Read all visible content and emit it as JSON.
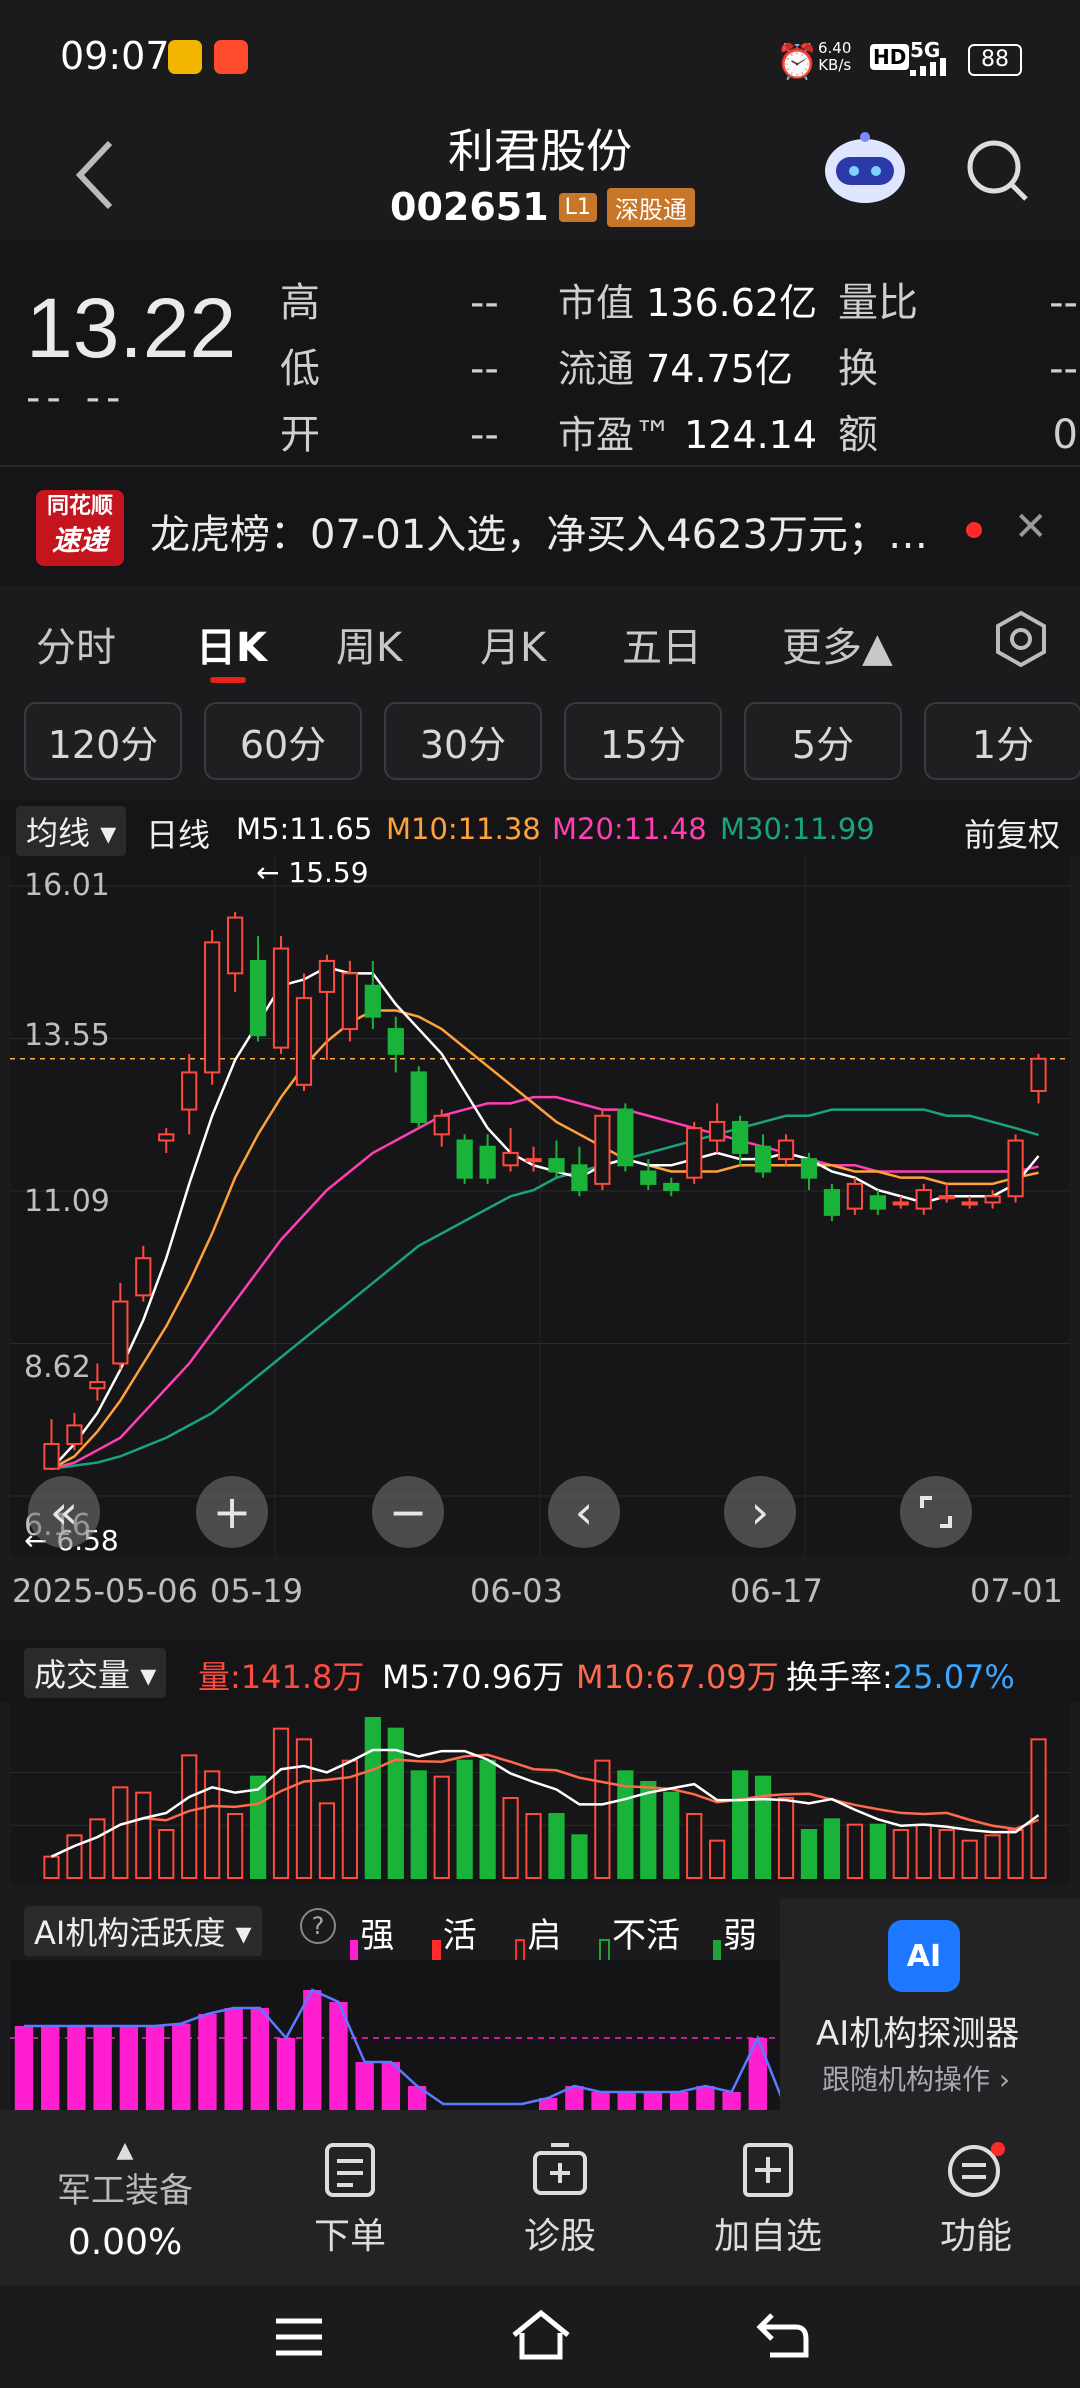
{
  "status_bar": {
    "time": "09:07",
    "net_speed_top": "6.40",
    "net_speed_unit": "KB/s",
    "hd": "HD",
    "signal": "5G",
    "battery": "88"
  },
  "header": {
    "title": "利君股份",
    "code": "002651",
    "badge_l1": "L1",
    "badge_market": "深股通"
  },
  "quote": {
    "price": "13.22",
    "change": "-- --",
    "high_label": "高",
    "high": "--",
    "low_label": "低",
    "low": "--",
    "open_label": "开",
    "open": "--",
    "mktcap_label": "市值",
    "mktcap": "136.62亿",
    "float_label": "流通",
    "float": "74.75亿",
    "pe_label": "市盈™",
    "pe": "124.14",
    "volratio_label": "量比",
    "volratio": "--",
    "turnover_label": "换",
    "turnover": "--",
    "amount_label": "额",
    "amount": "0"
  },
  "news": {
    "logo_top": "同花顺",
    "logo_bottom": "速递",
    "text": "龙虎榜：07-01入选，净买入4623万元；…"
  },
  "period_tabs": [
    "分时",
    "日K",
    "周K",
    "月K",
    "五日",
    "更多▲"
  ],
  "minute_chips": [
    "120分",
    "60分",
    "30分",
    "15分",
    "5分",
    "1分"
  ],
  "ma_bar": {
    "selector": "均线",
    "type": "日线",
    "m5": "M5:11.65",
    "m10": "M10:11.38",
    "m20": "M20:11.48",
    "m30": "M30:11.99",
    "adjust": "前复权"
  },
  "price_axis": [
    "16.01",
    "13.55",
    "11.09",
    "8.62",
    "6.16"
  ],
  "date_axis": [
    "2025-05-06",
    "05-19",
    "06-03",
    "06-17",
    "07-01"
  ],
  "max_marker": "15.59",
  "min_marker": "6.58",
  "chart_data": {
    "type": "candlestick",
    "ylim": [
      6.16,
      16.01
    ],
    "candles": [
      [
        6.6,
        7.0,
        7.4,
        6.58
      ],
      [
        7.0,
        7.3,
        7.5,
        6.9
      ],
      [
        7.9,
        8.0,
        8.3,
        7.7
      ],
      [
        8.3,
        9.3,
        9.6,
        8.2
      ],
      [
        9.4,
        10.0,
        10.2,
        9.3
      ],
      [
        11.9,
        12.0,
        12.1,
        11.7
      ],
      [
        12.4,
        13.0,
        13.3,
        12.0
      ],
      [
        13.0,
        15.1,
        15.3,
        12.8
      ],
      [
        14.6,
        15.5,
        15.59,
        14.3
      ],
      [
        14.8,
        13.6,
        15.2,
        13.5
      ],
      [
        13.4,
        15.0,
        15.2,
        13.3
      ],
      [
        12.8,
        14.2,
        14.6,
        12.7
      ],
      [
        14.3,
        14.8,
        14.9,
        13.2
      ],
      [
        13.7,
        14.6,
        14.8,
        13.5
      ],
      [
        14.4,
        13.9,
        14.8,
        13.7
      ],
      [
        13.7,
        13.3,
        13.9,
        13.0
      ],
      [
        13.0,
        12.2,
        13.1,
        12.1
      ],
      [
        12.0,
        12.3,
        12.4,
        11.8
      ],
      [
        11.9,
        11.3,
        12.0,
        11.2
      ],
      [
        11.8,
        11.3,
        12.0,
        11.2
      ],
      [
        11.5,
        11.7,
        12.1,
        11.4
      ],
      [
        11.6,
        11.6,
        11.8,
        11.4
      ],
      [
        11.6,
        11.4,
        11.9,
        11.3
      ],
      [
        11.5,
        11.1,
        11.8,
        11.0
      ],
      [
        11.2,
        12.3,
        12.4,
        11.1
      ],
      [
        12.4,
        11.5,
        12.5,
        11.4
      ],
      [
        11.4,
        11.2,
        11.6,
        11.1
      ],
      [
        11.2,
        11.1,
        11.3,
        11.0
      ],
      [
        11.3,
        12.1,
        12.2,
        11.2
      ],
      [
        11.9,
        12.2,
        12.5,
        11.7
      ],
      [
        12.2,
        11.7,
        12.3,
        11.5
      ],
      [
        11.8,
        11.4,
        12.0,
        11.3
      ],
      [
        11.6,
        11.9,
        12.0,
        11.5
      ],
      [
        11.6,
        11.3,
        11.7,
        11.1
      ],
      [
        11.1,
        10.7,
        11.2,
        10.6
      ],
      [
        10.8,
        11.2,
        11.3,
        10.7
      ],
      [
        11.0,
        10.8,
        11.1,
        10.7
      ],
      [
        10.9,
        10.9,
        11.0,
        10.8
      ],
      [
        10.8,
        11.1,
        11.2,
        10.7
      ],
      [
        11.0,
        11.0,
        11.2,
        10.9
      ],
      [
        10.9,
        10.9,
        11.0,
        10.8
      ],
      [
        10.9,
        11.0,
        11.1,
        10.8
      ],
      [
        11.0,
        11.9,
        12.0,
        10.9
      ],
      [
        12.7,
        13.22,
        13.3,
        12.5
      ]
    ],
    "ma5": [
      6.6,
      7.0,
      7.5,
      8.2,
      9.0,
      10.0,
      11.2,
      12.3,
      13.2,
      13.8,
      14.4,
      14.5,
      14.7,
      14.6,
      14.6,
      14.1,
      13.7,
      13.3,
      12.7,
      12.1,
      11.7,
      11.5,
      11.4,
      11.3,
      11.5,
      11.6,
      11.5,
      11.5,
      11.6,
      11.7,
      11.6,
      11.6,
      11.7,
      11.6,
      11.4,
      11.3,
      11.1,
      11.0,
      10.9,
      11.0,
      11.0,
      11.0,
      11.2,
      11.65
    ],
    "ma10": [
      6.6,
      6.8,
      7.2,
      7.7,
      8.3,
      8.9,
      9.6,
      10.4,
      11.3,
      12.0,
      12.6,
      13.1,
      13.5,
      13.8,
      14.0,
      14.0,
      13.9,
      13.7,
      13.4,
      13.1,
      12.8,
      12.5,
      12.2,
      12.0,
      11.8,
      11.6,
      11.5,
      11.4,
      11.4,
      11.4,
      11.5,
      11.5,
      11.5,
      11.5,
      11.5,
      11.4,
      11.4,
      11.3,
      11.3,
      11.2,
      11.2,
      11.2,
      11.3,
      11.38
    ],
    "ma20": [
      6.6,
      6.7,
      6.9,
      7.1,
      7.5,
      7.9,
      8.3,
      8.8,
      9.3,
      9.8,
      10.3,
      10.7,
      11.1,
      11.4,
      11.7,
      11.9,
      12.1,
      12.3,
      12.4,
      12.5,
      12.5,
      12.6,
      12.6,
      12.5,
      12.4,
      12.4,
      12.3,
      12.2,
      12.1,
      12.0,
      11.9,
      11.8,
      11.7,
      11.6,
      11.5,
      11.5,
      11.4,
      11.4,
      11.4,
      11.4,
      11.4,
      11.4,
      11.4,
      11.48
    ],
    "ma30": [
      6.6,
      6.65,
      6.7,
      6.8,
      6.95,
      7.1,
      7.3,
      7.5,
      7.8,
      8.1,
      8.4,
      8.7,
      9.0,
      9.3,
      9.6,
      9.9,
      10.2,
      10.4,
      10.6,
      10.8,
      11.0,
      11.1,
      11.3,
      11.4,
      11.5,
      11.6,
      11.7,
      11.8,
      11.9,
      12.0,
      12.1,
      12.2,
      12.3,
      12.3,
      12.4,
      12.4,
      12.4,
      12.4,
      12.4,
      12.3,
      12.3,
      12.2,
      12.1,
      11.99
    ],
    "volume": [
      20,
      40,
      55,
      85,
      80,
      45,
      115,
      100,
      60,
      95,
      140,
      130,
      70,
      110,
      150,
      140,
      100,
      95,
      110,
      110,
      75,
      60,
      60,
      40,
      110,
      100,
      90,
      80,
      60,
      35,
      100,
      95,
      75,
      45,
      55,
      50,
      50,
      45,
      50,
      45,
      35,
      40,
      45,
      130
    ],
    "ai_activity": [
      70,
      70,
      70,
      70,
      70,
      70,
      72,
      80,
      85,
      85,
      60,
      100,
      90,
      40,
      40,
      20,
      5,
      5,
      5,
      5,
      10,
      20,
      15,
      15,
      15,
      15,
      20,
      15,
      60,
      5,
      5,
      5,
      5,
      5,
      5,
      30,
      55,
      60,
      35,
      5,
      5,
      5,
      5,
      5
    ]
  },
  "volume_bar": {
    "selector": "成交量",
    "vol": "量:141.8万",
    "m5": "M5:70.96万",
    "m10": "M10:67.09万",
    "turnover_label": "换手率:",
    "turnover": "25.07%"
  },
  "ai_bar": {
    "selector": "AI机构活跃度",
    "help": "?",
    "legend": [
      "强势",
      "活跃",
      "启动",
      "不活跃",
      "弱势"
    ]
  },
  "ai_promo": {
    "icon": "AI",
    "title": "AI机构探测器",
    "subtitle": "跟随机构操作 ›"
  },
  "bottom_nav": {
    "sector": "军工装备",
    "sector_pct": "0.00%",
    "items": [
      "下单",
      "诊股",
      "加自选",
      "功能"
    ]
  },
  "colors": {
    "up": "#ff4a3d",
    "down": "#19b33a",
    "ma5": "#ffffff",
    "ma10": "#ffa23a",
    "ma20": "#ff3fb3",
    "ma30": "#18a57b",
    "brand": "#c4141e"
  }
}
